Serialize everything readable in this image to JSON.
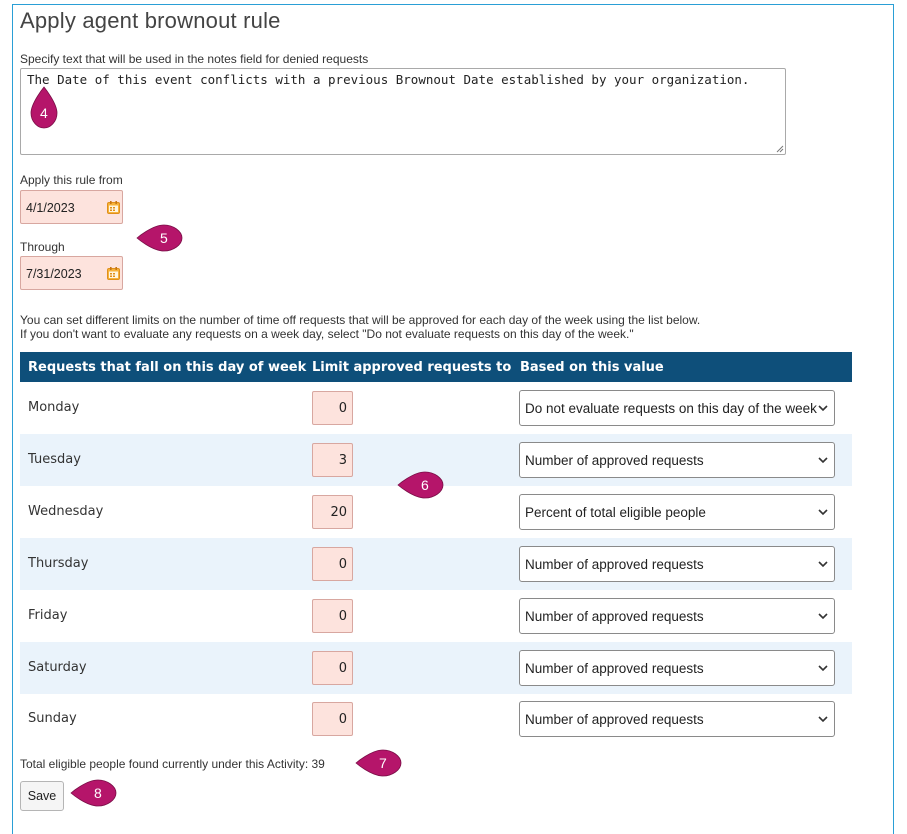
{
  "page": {
    "title": "Apply agent brownout rule",
    "notes_label": "Specify text that will be used in the notes field for denied requests",
    "notes_value": "The Date of this event conflicts with a previous Brownout Date established by your organization.",
    "from_label": "Apply this rule from",
    "from_value": "4/1/2023",
    "through_label": "Through",
    "through_value": "7/31/2023",
    "info_line1": "You can set different limits on the number of time off requests that will be approved for each day of the week using the list below.",
    "info_line2": "If you don't want to evaluate any requests on a week day, select \"Do not evaluate requests on this day of the week.\"",
    "total_text": "Total eligible people found currently under this Activity: 39",
    "save_label": "Save"
  },
  "table": {
    "headers": [
      "Requests that fall on this day of week",
      "Limit approved requests to",
      "Based on this value"
    ],
    "rows": [
      {
        "day": "Monday",
        "limit": "0",
        "basis": "Do not evaluate requests on this day of the week"
      },
      {
        "day": "Tuesday",
        "limit": "3",
        "basis": "Number of approved requests"
      },
      {
        "day": "Wednesday",
        "limit": "20",
        "basis": "Percent of total eligible people"
      },
      {
        "day": "Thursday",
        "limit": "0",
        "basis": "Number of approved requests"
      },
      {
        "day": "Friday",
        "limit": "0",
        "basis": "Number of approved requests"
      },
      {
        "day": "Saturday",
        "limit": "0",
        "basis": "Number of approved requests"
      },
      {
        "day": "Sunday",
        "limit": "0",
        "basis": "Number of approved requests"
      }
    ]
  },
  "callouts": {
    "c4": "4",
    "c5": "5",
    "c6": "6",
    "c7": "7",
    "c8": "8"
  },
  "colors": {
    "header_bg": "#0e4f7a",
    "callout": "#b5156a",
    "input_bg": "#fde3dd",
    "frame": "#2a9fd6",
    "row_alt": "#eaf3fb"
  },
  "icons": {
    "date": "calendar-icon",
    "select": "chevron-down-icon",
    "textarea": "resize-handle-icon"
  }
}
